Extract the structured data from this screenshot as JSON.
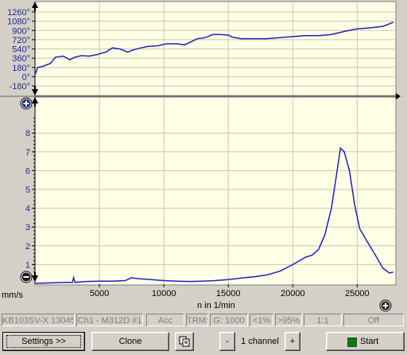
{
  "top_chart": {
    "y_ticks": [
      "1260°",
      "1080°",
      "900°",
      "720°",
      "540°",
      "360°",
      "180°",
      "0°",
      "-180°"
    ]
  },
  "chart_data": [
    {
      "type": "line",
      "chart": "phase",
      "ylim": [
        -180,
        1260
      ],
      "xlim": [
        0,
        28000
      ],
      "series": [
        {
          "color": "#2020c0",
          "points": [
            [
              0,
              30
            ],
            [
              200,
              180
            ],
            [
              600,
              200
            ],
            [
              1200,
              260
            ],
            [
              1600,
              380
            ],
            [
              2200,
              400
            ],
            [
              2700,
              330
            ],
            [
              3100,
              380
            ],
            [
              3600,
              410
            ],
            [
              4200,
              400
            ],
            [
              4800,
              430
            ],
            [
              5500,
              480
            ],
            [
              6000,
              560
            ],
            [
              6600,
              540
            ],
            [
              7200,
              480
            ],
            [
              7600,
              520
            ],
            [
              8200,
              560
            ],
            [
              8800,
              590
            ],
            [
              9500,
              600
            ],
            [
              10200,
              640
            ],
            [
              11000,
              640
            ],
            [
              11600,
              620
            ],
            [
              12200,
              690
            ],
            [
              12600,
              740
            ],
            [
              13200,
              760
            ],
            [
              13800,
              820
            ],
            [
              14400,
              820
            ],
            [
              15000,
              810
            ],
            [
              15300,
              770
            ],
            [
              16000,
              740
            ],
            [
              17000,
              740
            ],
            [
              18000,
              740
            ],
            [
              19000,
              760
            ],
            [
              20000,
              780
            ],
            [
              21000,
              800
            ],
            [
              22000,
              800
            ],
            [
              23000,
              820
            ],
            [
              24000,
              880
            ],
            [
              25000,
              930
            ],
            [
              26000,
              950
            ],
            [
              27000,
              980
            ],
            [
              27800,
              1060
            ]
          ]
        }
      ]
    },
    {
      "type": "line",
      "chart": "velocity",
      "xlabel": "n in 1/min",
      "ylabel": "mm/s",
      "xlim": [
        0,
        28000
      ],
      "ylim": [
        0,
        9
      ],
      "x_ticks": [
        "5000",
        "10000",
        "15000",
        "20000",
        "25000"
      ],
      "y_ticks": [
        "1",
        "2",
        "3",
        "4",
        "5",
        "6",
        "7",
        "8"
      ],
      "series": [
        {
          "color": "#2020c0",
          "points": [
            [
              0,
              0
            ],
            [
              2500,
              0.05
            ],
            [
              2900,
              0.05
            ],
            [
              3000,
              0.3
            ],
            [
              3100,
              0.05
            ],
            [
              4000,
              0.1
            ],
            [
              5000,
              0.12
            ],
            [
              6000,
              0.12
            ],
            [
              7000,
              0.15
            ],
            [
              7500,
              0.3
            ],
            [
              8000,
              0.25
            ],
            [
              9000,
              0.2
            ],
            [
              10000,
              0.15
            ],
            [
              11000,
              0.12
            ],
            [
              12000,
              0.1
            ],
            [
              13000,
              0.12
            ],
            [
              14000,
              0.15
            ],
            [
              15000,
              0.2
            ],
            [
              16000,
              0.28
            ],
            [
              17000,
              0.35
            ],
            [
              18000,
              0.45
            ],
            [
              19000,
              0.65
            ],
            [
              20000,
              1.0
            ],
            [
              21000,
              1.4
            ],
            [
              21500,
              1.5
            ],
            [
              22000,
              1.8
            ],
            [
              22500,
              2.6
            ],
            [
              23000,
              4.0
            ],
            [
              23400,
              5.8
            ],
            [
              23700,
              7.2
            ],
            [
              24000,
              7.0
            ],
            [
              24400,
              6.0
            ],
            [
              24800,
              4.2
            ],
            [
              25200,
              2.9
            ],
            [
              25800,
              2.2
            ],
            [
              26500,
              1.4
            ],
            [
              27000,
              0.8
            ],
            [
              27500,
              0.55
            ],
            [
              27800,
              0.6
            ]
          ]
        }
      ]
    }
  ],
  "status": [
    "KB103SV-X 13045",
    "Ch1 - M312D #1",
    "Acc",
    "TRMS",
    "G: 1000",
    "<1%",
    ">95%",
    "1:1",
    "Off"
  ],
  "buttons": {
    "settings": "Settings >>",
    "clone": "Clone",
    "minus": "-",
    "channel": "1 channel",
    "plus": "+",
    "start": "Start"
  },
  "colors": {
    "plot_bg": "#ffffe6",
    "trace": "#2020c0",
    "grid": "#c8c8b4",
    "start_indicator": "#008000"
  }
}
